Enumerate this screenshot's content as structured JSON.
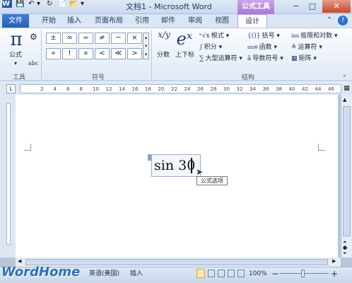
{
  "title_bar": {
    "doc_title": "文档1 - Microsoft Word",
    "context_tool_label": "公式工具",
    "quick_access": [
      "W",
      "💾",
      "↶",
      "▾",
      "↻",
      "📄",
      "📂",
      "▾"
    ],
    "window_buttons": {
      "minimize": "−",
      "maximize": "□",
      "close": "✕"
    }
  },
  "tabs": {
    "file": "文件",
    "home": "开始",
    "insert": "插入",
    "layout": "页面布局",
    "references": "引用",
    "mailings": "邮件",
    "review": "审阅",
    "view": "视图",
    "design": "设计"
  },
  "ribbon": {
    "tools_group": {
      "label": "工具",
      "equation": {
        "glyph": "π",
        "label": "公式"
      },
      "small_icons": [
        "⚙",
        "abc"
      ]
    },
    "symbols_group": {
      "label": "符号",
      "row1": [
        "±",
        "∞",
        "=",
        "≠",
        "~",
        "×"
      ],
      "row2": [
        "÷",
        "!",
        "∝",
        "<",
        "≪",
        ">"
      ]
    },
    "structures_group": {
      "label": "结构",
      "fraction": {
        "glyph": "x/y",
        "label": "分数"
      },
      "script": {
        "glyph": "eˣ",
        "label": "上下标"
      },
      "radical": {
        "icon": "ⁿ√x",
        "label": "根式"
      },
      "integral": {
        "icon": "∫",
        "label": "积分"
      },
      "large_operator": {
        "icon": "∑",
        "label": "大型运算符"
      },
      "bracket": {
        "icon": "{()}",
        "label": "括号"
      },
      "function": {
        "icon": "sinθ",
        "label": "函数"
      },
      "accent": {
        "icon": "ä",
        "label": "导数符号"
      },
      "limit_log": {
        "icon": "lim",
        "label": "极限和对数"
      },
      "operator": {
        "icon": "≜",
        "label": "运算符"
      },
      "matrix": {
        "icon": "▦",
        "label": "矩阵"
      }
    }
  },
  "ruler_ticks": [
    "2",
    "4",
    "6",
    "8",
    "10",
    "12",
    "14",
    "16",
    "18",
    "20",
    "22",
    "24",
    "26",
    "28",
    "30",
    "32",
    "34",
    "36",
    "38",
    "40",
    "42",
    "44",
    "46"
  ],
  "document": {
    "equation_text": "sin 30",
    "tooltip": "公式选项"
  },
  "status_bar": {
    "watermark": "WordHome",
    "language": "英语(美国)",
    "insert_mode": "插入",
    "zoom": "100%",
    "zoom_out": "−",
    "zoom_in": "+"
  },
  "colors": {
    "accent_blue": "#2a5fb0",
    "context_purple": "#a979d3"
  }
}
